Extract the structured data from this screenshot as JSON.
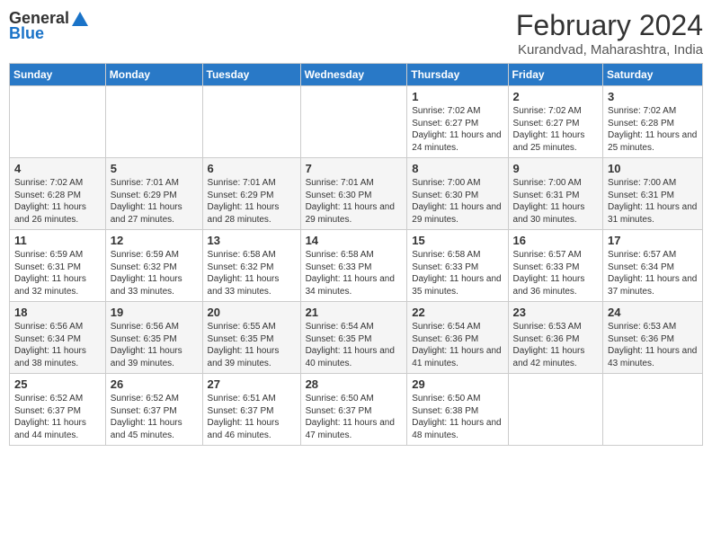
{
  "header": {
    "logo_general": "General",
    "logo_blue": "Blue",
    "month_title": "February 2024",
    "subtitle": "Kurandvad, Maharashtra, India"
  },
  "weekdays": [
    "Sunday",
    "Monday",
    "Tuesday",
    "Wednesday",
    "Thursday",
    "Friday",
    "Saturday"
  ],
  "weeks": [
    [
      {
        "day": "",
        "info": ""
      },
      {
        "day": "",
        "info": ""
      },
      {
        "day": "",
        "info": ""
      },
      {
        "day": "",
        "info": ""
      },
      {
        "day": "1",
        "info": "Sunrise: 7:02 AM\nSunset: 6:27 PM\nDaylight: 11 hours and 24 minutes."
      },
      {
        "day": "2",
        "info": "Sunrise: 7:02 AM\nSunset: 6:27 PM\nDaylight: 11 hours and 25 minutes."
      },
      {
        "day": "3",
        "info": "Sunrise: 7:02 AM\nSunset: 6:28 PM\nDaylight: 11 hours and 25 minutes."
      }
    ],
    [
      {
        "day": "4",
        "info": "Sunrise: 7:02 AM\nSunset: 6:28 PM\nDaylight: 11 hours and 26 minutes."
      },
      {
        "day": "5",
        "info": "Sunrise: 7:01 AM\nSunset: 6:29 PM\nDaylight: 11 hours and 27 minutes."
      },
      {
        "day": "6",
        "info": "Sunrise: 7:01 AM\nSunset: 6:29 PM\nDaylight: 11 hours and 28 minutes."
      },
      {
        "day": "7",
        "info": "Sunrise: 7:01 AM\nSunset: 6:30 PM\nDaylight: 11 hours and 29 minutes."
      },
      {
        "day": "8",
        "info": "Sunrise: 7:00 AM\nSunset: 6:30 PM\nDaylight: 11 hours and 29 minutes."
      },
      {
        "day": "9",
        "info": "Sunrise: 7:00 AM\nSunset: 6:31 PM\nDaylight: 11 hours and 30 minutes."
      },
      {
        "day": "10",
        "info": "Sunrise: 7:00 AM\nSunset: 6:31 PM\nDaylight: 11 hours and 31 minutes."
      }
    ],
    [
      {
        "day": "11",
        "info": "Sunrise: 6:59 AM\nSunset: 6:31 PM\nDaylight: 11 hours and 32 minutes."
      },
      {
        "day": "12",
        "info": "Sunrise: 6:59 AM\nSunset: 6:32 PM\nDaylight: 11 hours and 33 minutes."
      },
      {
        "day": "13",
        "info": "Sunrise: 6:58 AM\nSunset: 6:32 PM\nDaylight: 11 hours and 33 minutes."
      },
      {
        "day": "14",
        "info": "Sunrise: 6:58 AM\nSunset: 6:33 PM\nDaylight: 11 hours and 34 minutes."
      },
      {
        "day": "15",
        "info": "Sunrise: 6:58 AM\nSunset: 6:33 PM\nDaylight: 11 hours and 35 minutes."
      },
      {
        "day": "16",
        "info": "Sunrise: 6:57 AM\nSunset: 6:33 PM\nDaylight: 11 hours and 36 minutes."
      },
      {
        "day": "17",
        "info": "Sunrise: 6:57 AM\nSunset: 6:34 PM\nDaylight: 11 hours and 37 minutes."
      }
    ],
    [
      {
        "day": "18",
        "info": "Sunrise: 6:56 AM\nSunset: 6:34 PM\nDaylight: 11 hours and 38 minutes."
      },
      {
        "day": "19",
        "info": "Sunrise: 6:56 AM\nSunset: 6:35 PM\nDaylight: 11 hours and 39 minutes."
      },
      {
        "day": "20",
        "info": "Sunrise: 6:55 AM\nSunset: 6:35 PM\nDaylight: 11 hours and 39 minutes."
      },
      {
        "day": "21",
        "info": "Sunrise: 6:54 AM\nSunset: 6:35 PM\nDaylight: 11 hours and 40 minutes."
      },
      {
        "day": "22",
        "info": "Sunrise: 6:54 AM\nSunset: 6:36 PM\nDaylight: 11 hours and 41 minutes."
      },
      {
        "day": "23",
        "info": "Sunrise: 6:53 AM\nSunset: 6:36 PM\nDaylight: 11 hours and 42 minutes."
      },
      {
        "day": "24",
        "info": "Sunrise: 6:53 AM\nSunset: 6:36 PM\nDaylight: 11 hours and 43 minutes."
      }
    ],
    [
      {
        "day": "25",
        "info": "Sunrise: 6:52 AM\nSunset: 6:37 PM\nDaylight: 11 hours and 44 minutes."
      },
      {
        "day": "26",
        "info": "Sunrise: 6:52 AM\nSunset: 6:37 PM\nDaylight: 11 hours and 45 minutes."
      },
      {
        "day": "27",
        "info": "Sunrise: 6:51 AM\nSunset: 6:37 PM\nDaylight: 11 hours and 46 minutes."
      },
      {
        "day": "28",
        "info": "Sunrise: 6:50 AM\nSunset: 6:37 PM\nDaylight: 11 hours and 47 minutes."
      },
      {
        "day": "29",
        "info": "Sunrise: 6:50 AM\nSunset: 6:38 PM\nDaylight: 11 hours and 48 minutes."
      },
      {
        "day": "",
        "info": ""
      },
      {
        "day": "",
        "info": ""
      }
    ]
  ]
}
